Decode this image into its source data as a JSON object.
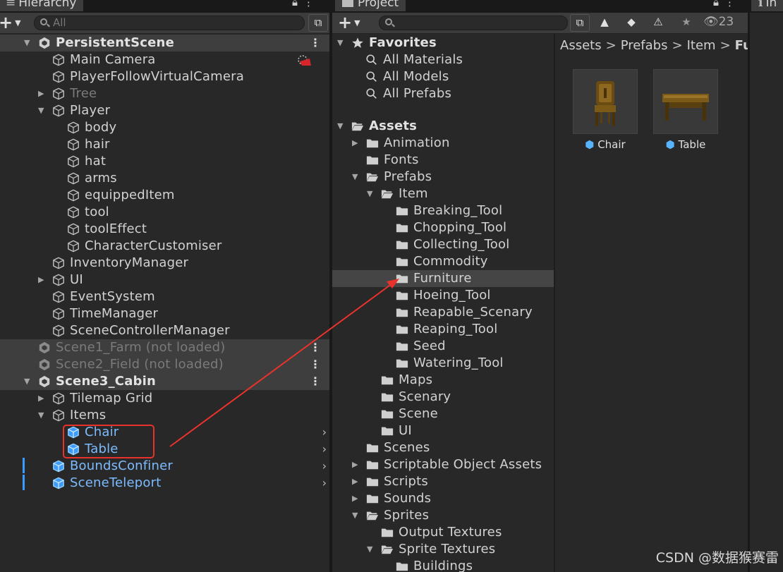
{
  "hierarchy": {
    "tab_label": "Hierarchy",
    "search_placeholder": "All",
    "rows": [
      {
        "label": "PersistentScene",
        "type": "scene"
      },
      {
        "label": "Main Camera"
      },
      {
        "label": "PlayerFollowVirtualCamera"
      },
      {
        "label": "Tree"
      },
      {
        "label": "Player"
      },
      {
        "label": "body"
      },
      {
        "label": "hair"
      },
      {
        "label": "hat"
      },
      {
        "label": "arms"
      },
      {
        "label": "equippedItem"
      },
      {
        "label": "tool"
      },
      {
        "label": "toolEffect"
      },
      {
        "label": "CharacterCustomiser"
      },
      {
        "label": "InventoryManager"
      },
      {
        "label": "UI"
      },
      {
        "label": "EventSystem"
      },
      {
        "label": "TimeManager"
      },
      {
        "label": "SceneControllerManager"
      },
      {
        "label": "Scene1_Farm (not loaded)",
        "type": "scene"
      },
      {
        "label": "Scene2_Field (not loaded)",
        "type": "scene"
      },
      {
        "label": "Scene3_Cabin",
        "type": "scene"
      },
      {
        "label": "Tilemap Grid"
      },
      {
        "label": "Items"
      },
      {
        "label": "Chair"
      },
      {
        "label": "Table"
      },
      {
        "label": "BoundsConfiner"
      },
      {
        "label": "SceneTeleport"
      }
    ]
  },
  "project": {
    "tab_label": "Project",
    "visible_count": "23",
    "favorites": {
      "label": "Favorites",
      "items": [
        "All Materials",
        "All Models",
        "All Prefabs"
      ]
    },
    "tree": [
      "Assets",
      "Animation",
      "Fonts",
      "Prefabs",
      "Item",
      "Breaking_Tool",
      "Chopping_Tool",
      "Collecting_Tool",
      "Commodity",
      "Furniture",
      "Hoeing_Tool",
      "Reapable_Scenary",
      "Reaping_Tool",
      "Seed",
      "Watering_Tool",
      "Maps",
      "Scenary",
      "Scene",
      "UI",
      "Scenes",
      "Scriptable Object Assets",
      "Scripts",
      "Sounds",
      "Sprites",
      "Output Textures",
      "Sprite Textures",
      "Buildings"
    ],
    "breadcrumb": [
      "Assets",
      "Prefabs",
      "Item",
      "Furn"
    ],
    "assets": [
      {
        "name": "Chair",
        "icon": "chair-prefab-icon"
      },
      {
        "name": "Table",
        "icon": "table-prefab-icon"
      }
    ]
  },
  "inspector": {
    "tab_label": "In"
  },
  "watermark": "CSDN @数据猴赛雷",
  "colors": {
    "prefab_blue": "#7dbbff",
    "annotation_red": "#e8322b",
    "panel_bg": "#282828",
    "selected_row": "#454545"
  }
}
